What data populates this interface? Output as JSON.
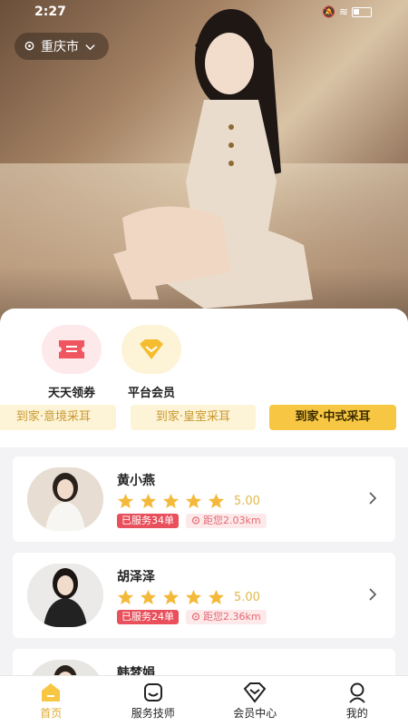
{
  "status": {
    "time": "2:27"
  },
  "location": {
    "city": "重庆市"
  },
  "quick_actions": [
    {
      "label": "天天领券",
      "icon": "ticket-icon"
    },
    {
      "label": "平台会员",
      "icon": "diamond-icon"
    }
  ],
  "service_tags": [
    {
      "label": "到家·意境采耳",
      "active": false
    },
    {
      "label": "到家·皇室采耳",
      "active": false
    },
    {
      "label": "到家·中式采耳",
      "active": true
    }
  ],
  "technicians": [
    {
      "name": "黄小燕",
      "rating": "5.00",
      "stars": 5,
      "served": "已服务34单",
      "distance": "距您2.03km"
    },
    {
      "name": "胡泽泽",
      "rating": "5.00",
      "stars": 5,
      "served": "已服务24单",
      "distance": "距您2.36km"
    },
    {
      "name": "韩梦娟"
    }
  ],
  "tabs": [
    {
      "label": "首页",
      "icon": "home-icon",
      "active": true
    },
    {
      "label": "服务技师",
      "icon": "technician-icon",
      "active": false
    },
    {
      "label": "会员中心",
      "icon": "vip-icon",
      "active": false
    },
    {
      "label": "我的",
      "icon": "profile-icon",
      "active": false
    }
  ],
  "colors": {
    "accent": "#f7c744",
    "served_badge": "#e8505b",
    "star": "#f4b93a"
  }
}
